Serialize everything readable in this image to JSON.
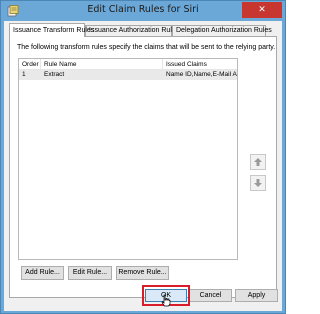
{
  "window": {
    "title": "Edit Claim Rules for Siri",
    "close_glyph": "✕",
    "icon": "claims-app-icon"
  },
  "tabs": [
    {
      "label": "Issuance Transform Rules",
      "active": true
    },
    {
      "label": "Issuance Authorization Rules",
      "active": false
    },
    {
      "label": "Delegation Authorization Rules",
      "active": false
    }
  ],
  "panel": {
    "description": "The following transform rules specify the claims that will be sent to the relying party."
  },
  "table": {
    "columns": [
      "Order",
      "Rule Name",
      "Issued Claims"
    ],
    "rows": [
      {
        "order": "1",
        "rule_name": "Extract",
        "issued_claims": "Name ID,Name,E-Mail Ad..."
      }
    ]
  },
  "reorder": {
    "up_icon": "move-up-icon",
    "down_icon": "move-down-icon"
  },
  "rule_buttons": {
    "add": "Add Rule...",
    "edit": "Edit Rule...",
    "remove": "Remove Rule..."
  },
  "dialog_buttons": {
    "ok": "OK",
    "cancel": "Cancel",
    "apply": "Apply"
  },
  "colors": {
    "title_bar": "#6ba8d8",
    "close_button": "#c7372f",
    "highlight": "#d81e2a"
  }
}
